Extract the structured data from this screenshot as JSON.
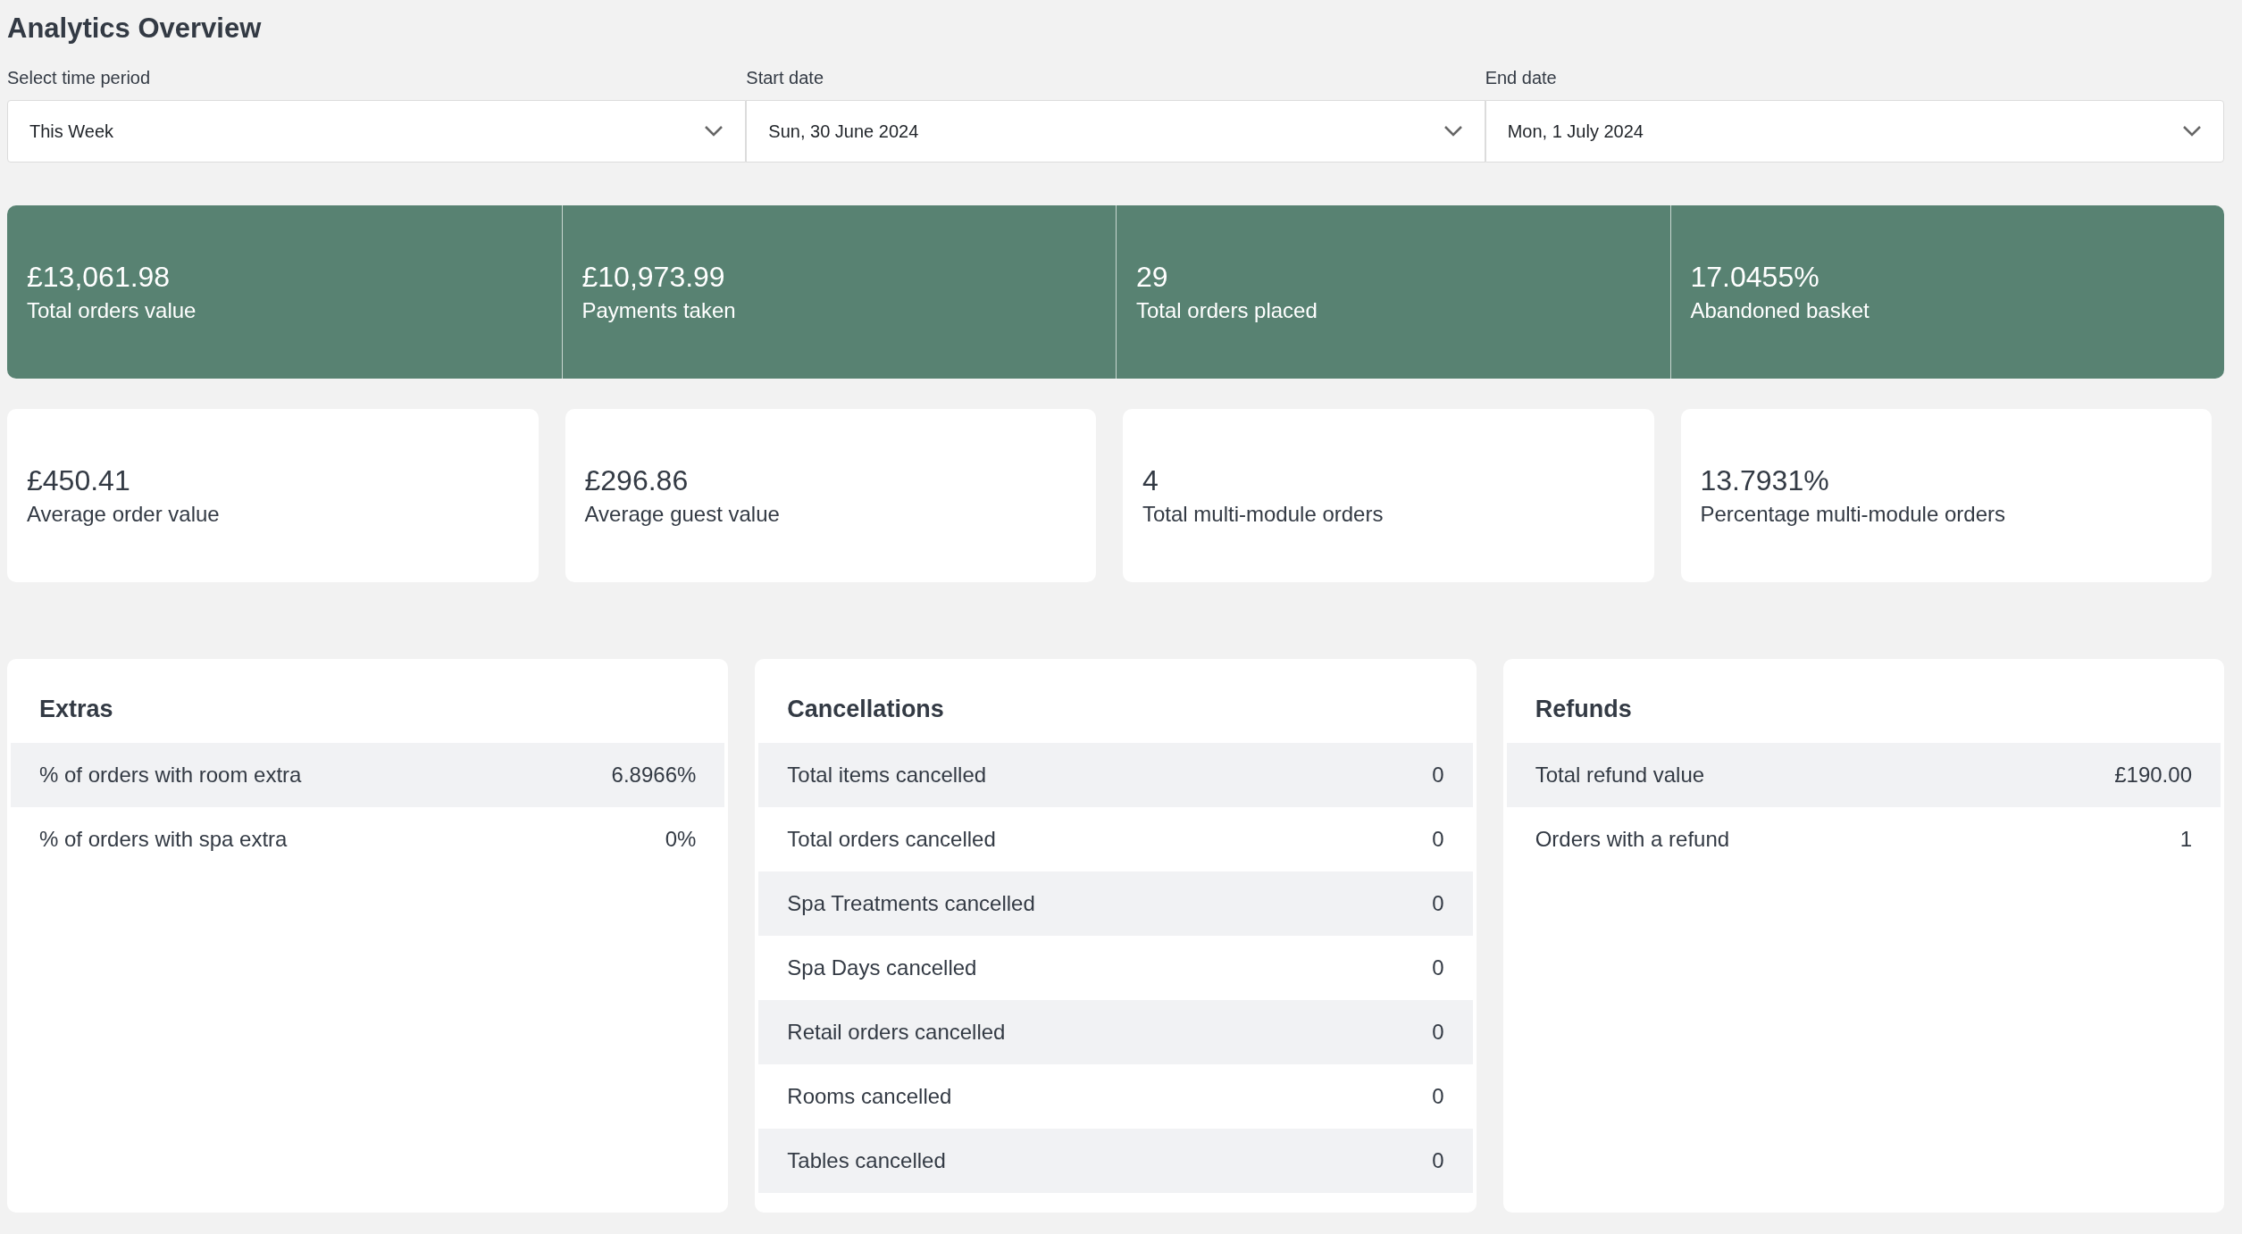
{
  "title": "Analytics Overview",
  "filters": [
    {
      "label": "Select time period",
      "value": "This Week"
    },
    {
      "label": "Start date",
      "value": "Sun, 30 June 2024"
    },
    {
      "label": "End date",
      "value": "Mon, 1 July 2024"
    }
  ],
  "highlight_metrics": [
    {
      "value": "£13,061.98",
      "label": "Total orders value"
    },
    {
      "value": "£10,973.99",
      "label": "Payments taken"
    },
    {
      "value": "29",
      "label": "Total orders placed"
    },
    {
      "value": "17.0455%",
      "label": "Abandoned basket"
    }
  ],
  "metrics": [
    {
      "value": "£450.41",
      "label": "Average order value"
    },
    {
      "value": "£296.86",
      "label": "Average guest value"
    },
    {
      "value": "4",
      "label": "Total multi-module orders"
    },
    {
      "value": "13.7931%",
      "label": "Percentage multi-module orders"
    }
  ],
  "panels": [
    {
      "title": "Extras",
      "rows": [
        {
          "label": "% of orders with room extra",
          "value": "6.8966%"
        },
        {
          "label": "% of orders with spa extra",
          "value": "0%"
        }
      ]
    },
    {
      "title": "Cancellations",
      "rows": [
        {
          "label": "Total items cancelled",
          "value": "0"
        },
        {
          "label": "Total orders cancelled",
          "value": "0"
        },
        {
          "label": "Spa Treatments cancelled",
          "value": "0"
        },
        {
          "label": "Spa Days cancelled",
          "value": "0"
        },
        {
          "label": "Retail orders cancelled",
          "value": "0"
        },
        {
          "label": "Rooms cancelled",
          "value": "0"
        },
        {
          "label": "Tables cancelled",
          "value": "0"
        }
      ]
    },
    {
      "title": "Refunds",
      "rows": [
        {
          "label": "Total refund value",
          "value": "£190.00"
        },
        {
          "label": "Orders with a refund",
          "value": "1"
        }
      ]
    }
  ]
}
